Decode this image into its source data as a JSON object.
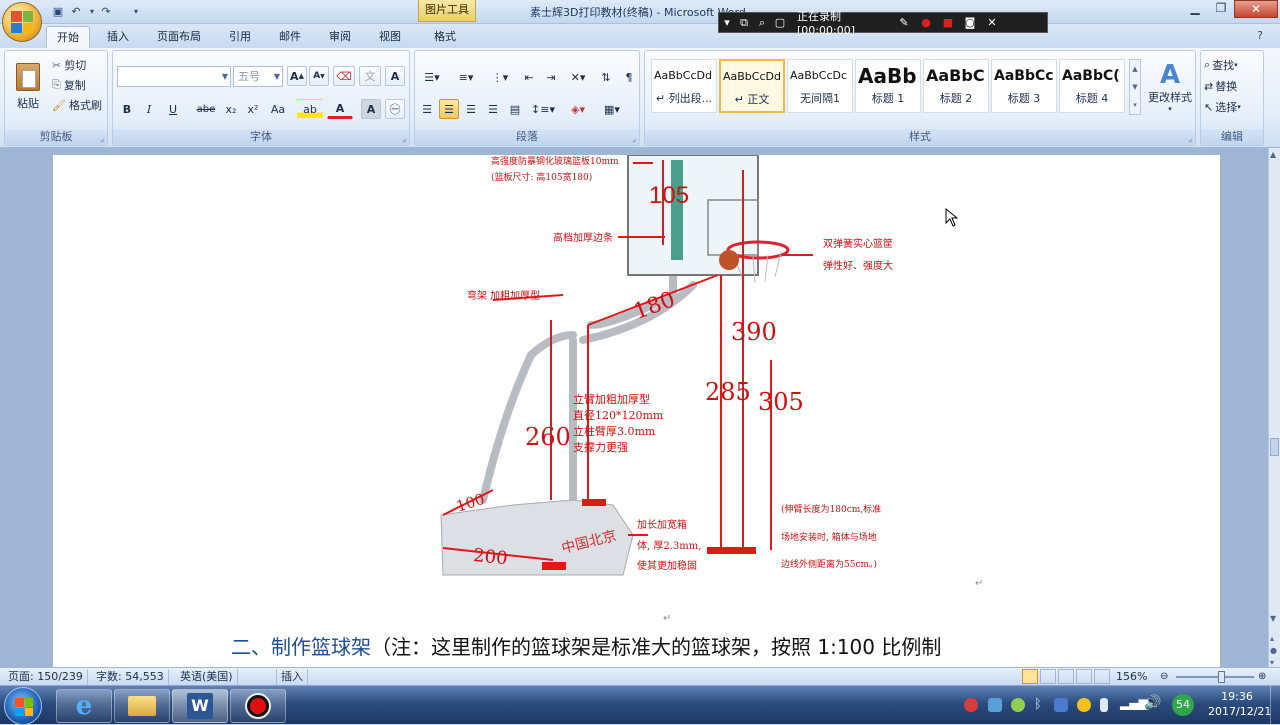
{
  "title_bar": {
    "context_tab": "图片工具",
    "title": "素士辉3D打印教材(终稿) - Microsoft Word",
    "quick_access": [
      "save-icon",
      "undo-icon",
      "redo-icon",
      "customize-icon"
    ]
  },
  "recorder": {
    "status": "正在录制 [00:00:00]"
  },
  "tabs": [
    "开始",
    "插入",
    "页面布局",
    "引用",
    "邮件",
    "审阅",
    "视图",
    "格式"
  ],
  "ribbon": {
    "clipboard": {
      "group_label": "剪贴板",
      "paste": "粘贴",
      "cut": "剪切",
      "copy": "复制",
      "format_painter": "格式刷"
    },
    "font": {
      "group_label": "字体",
      "font_name": "",
      "font_size": "五号",
      "bold": "B",
      "italic": "I",
      "underline": "U",
      "strike": "abe",
      "subscript": "x₂",
      "superscript": "x²",
      "change_case": "Aa",
      "grow": "A",
      "shrink": "A",
      "clear": "A",
      "char_border": "A",
      "font_color": "A",
      "highlight": "ab"
    },
    "paragraph": {
      "group_label": "段落"
    },
    "styles": {
      "group_label": "样式",
      "items": [
        {
          "sample": "AaBbCcDd",
          "name": "↵ 列出段..."
        },
        {
          "sample": "AaBbCcDd",
          "name": "↵ 正文"
        },
        {
          "sample": "AaBbCcDc",
          "name": "无间隔1"
        },
        {
          "sample": "AaBb",
          "name": "标题 1"
        },
        {
          "sample": "AaBbC",
          "name": "标题 2"
        },
        {
          "sample": "AaBbCc",
          "name": "标题 3"
        },
        {
          "sample": "AaBbC(",
          "name": "标题 4"
        }
      ],
      "change_styles": "更改样式"
    },
    "editing": {
      "group_label": "编辑",
      "find": "查找",
      "replace": "替换",
      "select": "选择"
    }
  },
  "document": {
    "figure": {
      "labels": {
        "board_thick": "高强度防暴钢化玻璃篮板10mm",
        "board_size": "(篮板尺寸: 高105宽180)",
        "d105": "105",
        "edge": "高档加厚边条",
        "rim1": "双弹簧实心篮筐",
        "rim2": "弹性好、强度大",
        "arm": "弯架 加粗加厚型",
        "d180": "180",
        "d390": "390",
        "d285": "285",
        "d305": "305",
        "d260": "260",
        "spec1": "立臂加粗加厚型",
        "spec2": "直径120*120mm",
        "spec3": "立柱臂厚3.0mm",
        "spec4": "支撑力更强",
        "d100": "100",
        "d200": "200",
        "box1": "加长加宽箱",
        "box2": "体, 厚2.3mm,",
        "box3": "使其更加稳固",
        "note1": "(伸臂长度为180cm,标准",
        "note2": "场地安装时, 箱体与场地",
        "note3": "边线外侧距离为55cm。)",
        "brand": "中国北京"
      },
      "return_mark": "↵"
    },
    "heading_prefix": "二、",
    "heading_blue": "制作篮球架",
    "heading_rest": "（注：这里制作的篮球架是标准大的篮球架，按照 1:100 比例制"
  },
  "status": {
    "page": "页面: 150/239",
    "words": "字数: 54,553",
    "language": "英语(美国)",
    "mode": "插入",
    "zoom": "156%"
  },
  "taskbar": {
    "time": "19:36",
    "date": "2017/12/21",
    "badge": "54"
  }
}
